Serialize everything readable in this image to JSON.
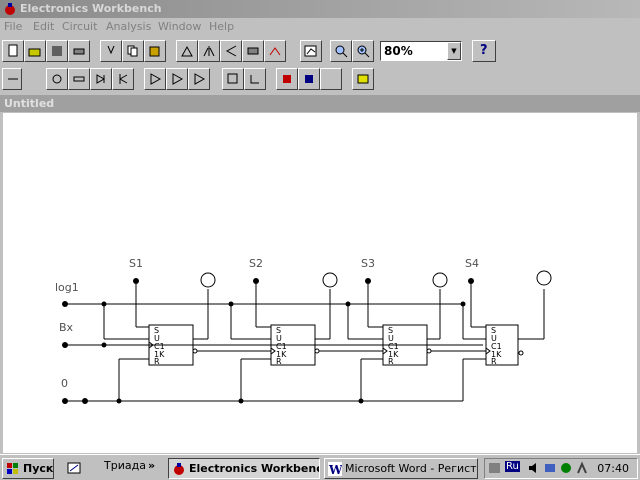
{
  "window": {
    "title": "Electronics Workbench"
  },
  "menu": [
    "File",
    "Edit",
    "Circuit",
    "Analysis",
    "Window",
    "Help"
  ],
  "toolbar": {
    "zoom_value": "80%",
    "help_label": "?"
  },
  "document": {
    "title": "Untitled"
  },
  "circuit": {
    "left_labels": {
      "log1": "log1",
      "bx": "Bx",
      "zero": "0"
    },
    "switch_labels": [
      "S1",
      "S2",
      "S3",
      "S4"
    ],
    "flipflop_pins": [
      "S",
      "U",
      "C1",
      "1K",
      "R"
    ]
  },
  "taskbar": {
    "start_label": "Пуск",
    "quick_launch_label": "Триада",
    "chevron": "»",
    "tasks": [
      "Electronics Workbench",
      "Microsoft Word - Регистр"
    ],
    "tray_lang": "Ru",
    "clock": "07:40"
  }
}
